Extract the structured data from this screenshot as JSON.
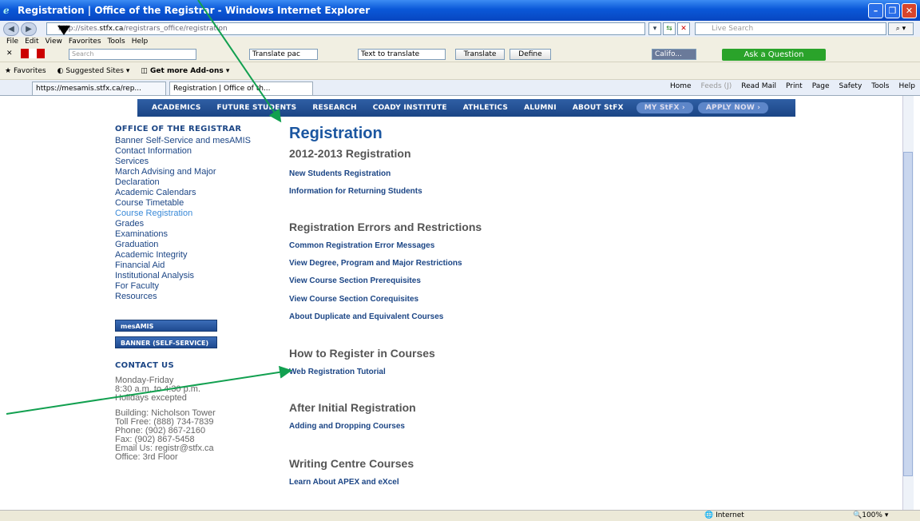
{
  "window": {
    "title": "Registration | Office of the Registrar - Windows Internet Explorer"
  },
  "address": {
    "prefix": "http://sites.",
    "domain": "stfx.ca",
    "path": "/registrars_office/registration",
    "search_placeholder": "Live Search"
  },
  "menu": [
    "File",
    "Edit",
    "View",
    "Favorites",
    "Tools",
    "Help"
  ],
  "toolbar": {
    "search_placeholder": "Search",
    "translate_page": "Translate pac",
    "text_to_translate": "Text to translate",
    "translate_btn": "Translate",
    "define_btn": "Define",
    "addon_label": "Califo...",
    "ask_btn": "Ask a Question"
  },
  "favbar": {
    "favorites": "Favorites",
    "suggested": "Suggested Sites",
    "addons": "Get more Add-ons"
  },
  "tabs": [
    {
      "label": "https://mesamis.stfx.ca/rep..."
    },
    {
      "label": "Registration | Office of th..."
    }
  ],
  "commands": [
    "Home",
    "Feeds (J)",
    "Read Mail",
    "Print",
    "Page",
    "Safety",
    "Tools",
    "Help"
  ],
  "sitenav": [
    "ACADEMICS",
    "FUTURE STUDENTS",
    "RESEARCH",
    "COADY INSTITUTE",
    "ATHLETICS",
    "ALUMNI",
    "ABOUT StFX"
  ],
  "sitenav_pills": [
    "MY StFX ›",
    "APPLY NOW ›"
  ],
  "sidebar": {
    "heading": "OFFICE OF THE REGISTRAR",
    "links": [
      "Banner Self-Service and mesAMIS",
      "Contact Information",
      "Services",
      "March Advising and Major",
      "Declaration",
      "Academic Calendars",
      "Course Timetable",
      "Course Registration",
      "Grades",
      "Examinations",
      "Graduation",
      "Academic Integrity",
      "Financial Aid",
      "Institutional Analysis",
      "For Faculty",
      "Resources"
    ],
    "buttons": [
      "mesAMIS",
      "BANNER (SELF-SERVICE)"
    ],
    "contact_heading": "CONTACT US",
    "hours": "Monday-Friday\n8:30 a.m. to 4:30 p.m.\nHolidays excepted",
    "contact": "Building: Nicholson Tower\nToll Free: (888) 734-7839\nPhone: (902) 867-2160\nFax: (902) 867-5458\nEmail Us: registr@stfx.ca\nOffice: 3rd Floor"
  },
  "main": {
    "title": "Registration",
    "sections": [
      {
        "heading": "2012-2013 Registration",
        "links": [
          "New Students Registration",
          "Information for Returning Students"
        ]
      },
      {
        "heading": "Registration Errors and Restrictions",
        "links": [
          "Common Registration Error Messages",
          "View Degree, Program and Major Restrictions",
          "View Course Section Prerequisites",
          "View Course Section Corequisites",
          "About Duplicate and Equivalent Courses"
        ]
      },
      {
        "heading": "How to Register in Courses",
        "links": [
          "Web Registration Tutorial"
        ]
      },
      {
        "heading": "After Initial Registration",
        "links": [
          "Adding and Dropping Courses"
        ]
      },
      {
        "heading": "Writing Centre Courses",
        "links": [
          "Learn About APEX and eXcel"
        ]
      }
    ]
  },
  "status": {
    "zone": "Internet",
    "zoom": "100%"
  }
}
